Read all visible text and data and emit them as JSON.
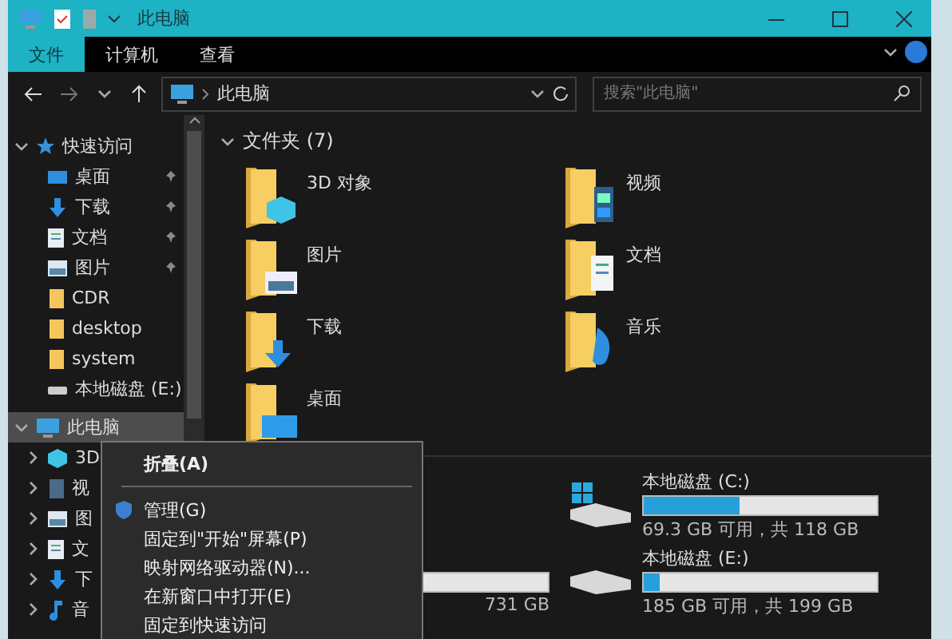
{
  "window": {
    "title": "此电脑"
  },
  "ribbon": {
    "tabs": [
      {
        "label": "文件",
        "selected": true
      },
      {
        "label": "计算机",
        "selected": false
      },
      {
        "label": "查看",
        "selected": false
      }
    ]
  },
  "address": {
    "path": "此电脑",
    "search_placeholder": "搜索\"此电脑\""
  },
  "sidebar": {
    "items": [
      {
        "label": "快速访问",
        "kind": "star",
        "expanded": true,
        "selected": false,
        "children": [
          {
            "label": "桌面",
            "kind": "desktop",
            "pinned": true
          },
          {
            "label": "下载",
            "kind": "downloads",
            "pinned": true
          },
          {
            "label": "文档",
            "kind": "documents",
            "pinned": true
          },
          {
            "label": "图片",
            "kind": "pictures",
            "pinned": true
          },
          {
            "label": "CDR",
            "kind": "folder",
            "pinned": false
          },
          {
            "label": "desktop",
            "kind": "folder",
            "pinned": false
          },
          {
            "label": "system",
            "kind": "folder",
            "pinned": false
          },
          {
            "label": "本地磁盘 (E:)",
            "kind": "drive",
            "pinned": false
          }
        ]
      },
      {
        "label": "此电脑",
        "kind": "pc",
        "expanded": true,
        "selected": true,
        "children": [
          {
            "label": "3D",
            "kind": "objects3d",
            "expanded": false
          },
          {
            "label": "视",
            "kind": "video",
            "expanded": false
          },
          {
            "label": "图",
            "kind": "pictures",
            "expanded": false
          },
          {
            "label": "文",
            "kind": "documents",
            "expanded": false
          },
          {
            "label": "下",
            "kind": "downloads",
            "expanded": false
          },
          {
            "label": "音",
            "kind": "music",
            "expanded": false
          }
        ]
      }
    ]
  },
  "folders": {
    "heading": "文件夹 (7)",
    "expanded": true,
    "items": [
      {
        "label": "3D 对象",
        "kind": "objects3d"
      },
      {
        "label": "视频",
        "kind": "video"
      },
      {
        "label": "图片",
        "kind": "pictures"
      },
      {
        "label": "文档",
        "kind": "documents"
      },
      {
        "label": "下载",
        "kind": "downloads"
      },
      {
        "label": "音乐",
        "kind": "music"
      },
      {
        "label": "桌面",
        "kind": "desktop"
      }
    ]
  },
  "drives": [
    {
      "name": "本地磁盘 (C:)",
      "kind": "system",
      "level": 0.41,
      "info": "69.3 GB 可用，共 118 GB"
    },
    {
      "kind": "plain",
      "info": "731 GB"
    },
    {
      "name": "本地磁盘 (E:)",
      "kind": "plain",
      "level": 0.07,
      "info": "185 GB 可用，共 199 GB"
    }
  ],
  "context_menu": {
    "items": [
      {
        "label": "折叠(A)",
        "kind": "default"
      },
      {
        "kind": "separator"
      },
      {
        "label": "管理(G)",
        "kind": "shield"
      },
      {
        "label": "固定到\"开始\"屏幕(P)",
        "kind": "plain"
      },
      {
        "label": "映射网络驱动器(N)...",
        "kind": "plain"
      },
      {
        "label": "在新窗口中打开(E)",
        "kind": "plain"
      },
      {
        "label": "固定到快速访问",
        "kind": "plain"
      }
    ]
  }
}
